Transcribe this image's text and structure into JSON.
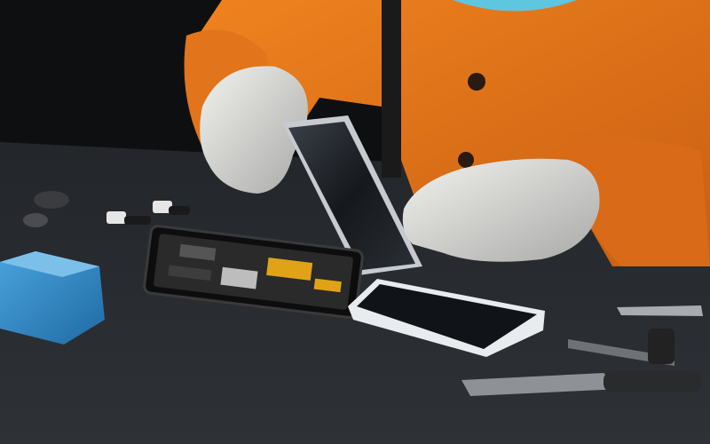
{
  "scene": {
    "subject": "phone-screen-repair",
    "palette": {
      "background": "#0e0f11",
      "table": "#2a2d31",
      "suit": "#e8741c",
      "suit_shadow": "#b9520f",
      "glove": "#d9d9d6",
      "cap": "#5fc6e0",
      "pcb": "#1a1a1a",
      "pcb_gold": "#e0a317",
      "box": "#2f86c4",
      "glass": "#1b1f24",
      "phone_frame": "#e9ecef"
    },
    "objects": [
      {
        "name": "technician",
        "icon": "person-in-protective-suit"
      },
      {
        "name": "left-glove",
        "icon": "glove-icon"
      },
      {
        "name": "right-glove",
        "icon": "glove-icon"
      },
      {
        "name": "screen-glass",
        "icon": "glass-panel"
      },
      {
        "name": "circuit-board",
        "icon": "pcb-icon"
      },
      {
        "name": "phone-body",
        "icon": "smartphone-icon"
      },
      {
        "name": "blue-box",
        "icon": "box-icon"
      },
      {
        "name": "small-parts",
        "icon": "connector-icon"
      },
      {
        "name": "tools",
        "icon": "tweezers-icon"
      }
    ]
  }
}
